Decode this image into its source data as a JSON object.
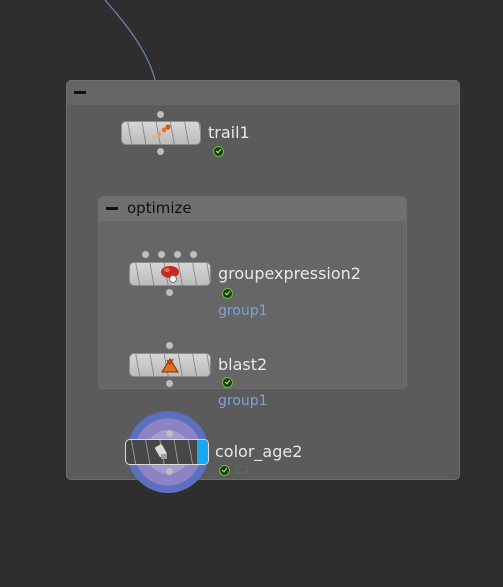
{
  "network": {
    "outer_box": {
      "title": ""
    },
    "inner_box": {
      "title": "optimize"
    },
    "nodes": [
      {
        "name": "trail1",
        "icon": "trail-icon",
        "flags": [
          "ok-flag"
        ]
      },
      {
        "name": "groupexpression2",
        "icon": "groupexpression-icon",
        "group": "group1",
        "flags": [
          "ok-flag",
          "bypass-flag"
        ]
      },
      {
        "name": "blast2",
        "icon": "blast-icon",
        "group": "group1",
        "flags": [
          "ok-flag"
        ]
      },
      {
        "name": "color_age2",
        "icon": "color-icon",
        "flags": [
          "ok-flag",
          "bypass-flag"
        ],
        "selected": true,
        "display": true
      }
    ]
  },
  "colors": {
    "background": "#2e2e2e",
    "network_box": "#5b5b5b",
    "wire": "#6d86b7",
    "group_label": "#7aa3d6",
    "display_flag": "#19a8ee",
    "halo": "#5c6fc0"
  }
}
